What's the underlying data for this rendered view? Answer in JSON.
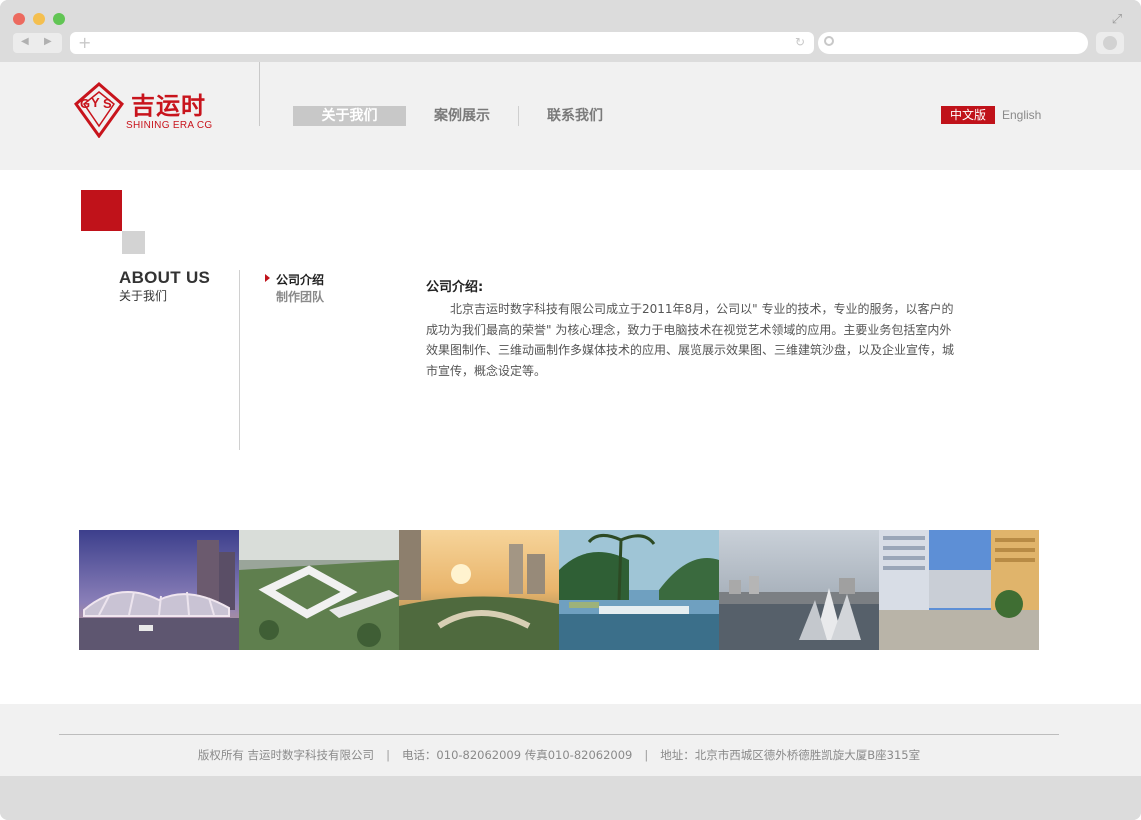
{
  "brand": {
    "name_cn": "吉运时",
    "name_en": "SHINING ERA CG",
    "accent_color": "#c0121a"
  },
  "nav": {
    "items": [
      {
        "label": "关于我们",
        "active": true
      },
      {
        "label": "案例展示",
        "active": false
      },
      {
        "label": "联系我们",
        "active": false
      }
    ]
  },
  "lang": {
    "cn_label": "中文版",
    "en_label": "English",
    "selected": "中文版"
  },
  "section": {
    "title_en": "ABOUT US",
    "title_cn": "关于我们"
  },
  "subnav": {
    "items": [
      {
        "label": "公司介绍",
        "active": true
      },
      {
        "label": "制作团队",
        "active": false
      }
    ]
  },
  "article": {
    "title": "公司介绍:",
    "body": "北京吉运时数字科技有限公司成立于2011年8月，公司以\" 专业的技术，专业的服务，以客户的成功为我们最高的荣誉\" 为核心理念，致力于电脑技术在视觉艺术领域的应用。主要业务包括室内外效果图制作、三维动画制作多媒体技术的应用、展览展示效果图、三维建筑沙盘，以及企业宣传，城市宣传，概念设定等。"
  },
  "gallery": {
    "images": [
      {
        "scene": "canopy-structure-dusk"
      },
      {
        "scene": "aerial-campus-green"
      },
      {
        "scene": "sunset-plaza-city"
      },
      {
        "scene": "tropical-waterfront-palms"
      },
      {
        "scene": "harbor-sail-sculpture"
      },
      {
        "scene": "street-buildings-blue-sky"
      }
    ]
  },
  "footer": {
    "copyright": "版权所有 吉运时数字科技有限公司",
    "phone": "电话：010-82062009 传真010-82062009",
    "address": "地址：北京市西城区德外桥德胜凯旋大厦B座315室"
  }
}
